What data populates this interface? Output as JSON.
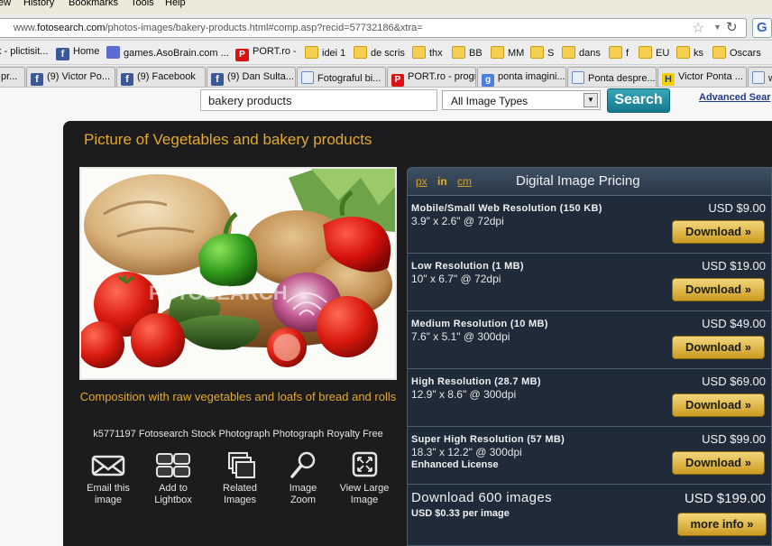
{
  "browser": {
    "menu": [
      "ew",
      "History",
      "Bookmarks",
      "Tools",
      "Help"
    ],
    "url_prefix": "www.",
    "url_domain": "fotosearch.com",
    "url_path": "/photos-images/bakery-products.html#comp.asp?recid=57732186&xtra=",
    "bookmarks": [
      {
        "label": "x - plictisit...",
        "icon": "page-icon"
      },
      {
        "label": "Home",
        "icon": "facebook-icon"
      },
      {
        "label": "games.AsoBrain.com ...",
        "icon": "games-icon"
      },
      {
        "label": "PORT.ro -",
        "icon": "port-icon"
      },
      {
        "label": "idei 1",
        "icon": "folder-icon"
      },
      {
        "label": "de scris",
        "icon": "folder-icon"
      },
      {
        "label": "thx",
        "icon": "folder-icon"
      },
      {
        "label": "BB",
        "icon": "folder-icon"
      },
      {
        "label": "MM",
        "icon": "folder-icon"
      },
      {
        "label": "S",
        "icon": "folder-icon"
      },
      {
        "label": "dans",
        "icon": "folder-icon"
      },
      {
        "label": "f",
        "icon": "folder-icon"
      },
      {
        "label": "EU",
        "icon": "folder-icon"
      },
      {
        "label": "ks",
        "icon": "folder-icon"
      },
      {
        "label": "Oscars",
        "icon": "folder-icon"
      }
    ],
    "tabs": [
      {
        "label": "pr...",
        "icon": "page-icon"
      },
      {
        "label": "(9) Victor Po...",
        "icon": "facebook-icon"
      },
      {
        "label": "(9) Facebook",
        "icon": "facebook-icon"
      },
      {
        "label": "(9) Dan Sulta...",
        "icon": "facebook-icon"
      },
      {
        "label": "Fotograful bi...",
        "icon": "fotosearch-icon"
      },
      {
        "label": "PORT.ro - progr...",
        "icon": "port-icon"
      },
      {
        "label": "ponta imagini...",
        "icon": "google-icon"
      },
      {
        "label": "Ponta despre...",
        "icon": "fotosearch-icon"
      },
      {
        "label": "Victor Ponta ...",
        "icon": "h-icon"
      },
      {
        "label": "w",
        "icon": "page-icon"
      }
    ]
  },
  "search": {
    "query": "bakery products",
    "type_selected": "All Image Types",
    "button_label": "Search",
    "advanced_label": "Advanced Sear"
  },
  "main": {
    "title": "Picture of Vegetables and bakery products",
    "photo_watermark": "FOTOSEARCH",
    "caption": "Composition with raw vegetables and loafs of bread and rolls",
    "stock_line": "k5771197 Fotosearch Stock Photograph Photograph Royalty Free",
    "actions": [
      {
        "line1": "Email this",
        "line2": "image",
        "icon": "email-icon"
      },
      {
        "line1": "Add to",
        "line2": "Lightbox",
        "icon": "lightbox-icon"
      },
      {
        "line1": "Related",
        "line2": "Images",
        "icon": "related-images-icon"
      },
      {
        "line1": "Image",
        "line2": "Zoom",
        "icon": "zoom-icon"
      },
      {
        "line1": "View Large",
        "line2": "Image",
        "icon": "view-large-icon"
      }
    ]
  },
  "pricing": {
    "units": [
      "px",
      "in",
      "cm"
    ],
    "units_selected": "in",
    "title": "Digital Image Pricing",
    "rows": [
      {
        "name": "Mobile/Small Web Resolution (150 KB)",
        "dims": "3.9\" x 2.6\" @ 72dpi",
        "license": "",
        "price": "USD $9.00",
        "button": "Download »"
      },
      {
        "name": "Low Resolution (1 MB)",
        "dims": "10\" x 6.7\" @ 72dpi",
        "license": "",
        "price": "USD $19.00",
        "button": "Download »"
      },
      {
        "name": "Medium Resolution (10 MB)",
        "dims": "7.6\" x 5.1\" @ 300dpi",
        "license": "",
        "price": "USD $49.00",
        "button": "Download »"
      },
      {
        "name": "High Resolution (28.7 MB)",
        "dims": "12.9\" x 8.6\" @ 300dpi",
        "license": "",
        "price": "USD $69.00",
        "button": "Download »"
      },
      {
        "name": "Super High Resolution (57 MB)",
        "dims": "18.3\" x 12.2\" @ 300dpi",
        "license": "Enhanced License",
        "price": "USD $99.00",
        "button": "Download »"
      }
    ],
    "bulk": {
      "title": "Download 600 images",
      "per": "USD $0.33 per image",
      "price": "USD $199.00",
      "button": "more info »"
    }
  }
}
